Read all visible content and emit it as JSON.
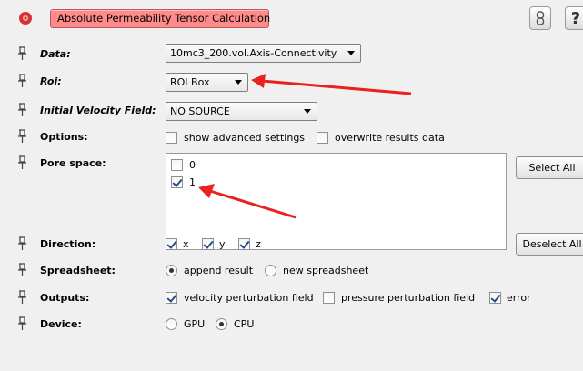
{
  "header": {
    "module_title": "Absolute Permeability Tensor Calculation",
    "icons": [
      "module-gear-icon",
      "link-icon",
      "help-icon"
    ],
    "help_symbol": "?"
  },
  "fields": {
    "data": {
      "label": "Data:",
      "value": "10mc3_200.vol.Axis-Connectivity"
    },
    "roi": {
      "label": "Roi:",
      "value": "ROI Box"
    },
    "initial_velocity": {
      "label": "Initial Velocity Field:",
      "value": "NO SOURCE"
    },
    "options": {
      "label": "Options:",
      "show_advanced": {
        "label": "show advanced settings",
        "checked": false
      },
      "overwrite": {
        "label": "overwrite results data",
        "checked": false
      }
    },
    "pore_space": {
      "label": "Pore space:",
      "items": [
        {
          "label": "0",
          "checked": false
        },
        {
          "label": "1",
          "checked": true
        }
      ],
      "select_all": "Select All",
      "deselect_all": "Deselect All"
    },
    "direction": {
      "label": "Direction:",
      "x": {
        "label": "x",
        "checked": true
      },
      "y": {
        "label": "y",
        "checked": true
      },
      "z": {
        "label": "z",
        "checked": true
      }
    },
    "spreadsheet": {
      "label": "Spreadsheet:",
      "append": {
        "label": "append result",
        "selected": true
      },
      "new": {
        "label": "new spreadsheet",
        "selected": false
      }
    },
    "outputs": {
      "label": "Outputs:",
      "velocity": {
        "label": "velocity perturbation field",
        "checked": true
      },
      "pressure": {
        "label": "pressure perturbation field",
        "checked": false
      },
      "error": {
        "label": "error",
        "checked": true
      }
    },
    "device": {
      "label": "Device:",
      "gpu": {
        "label": "GPU",
        "selected": false
      },
      "cpu": {
        "label": "CPU",
        "selected": true
      }
    }
  },
  "colors": {
    "module_title_bg": "#ff8a8a",
    "annotation_arrow": "#e8231f",
    "background": "#f0f0f0"
  }
}
